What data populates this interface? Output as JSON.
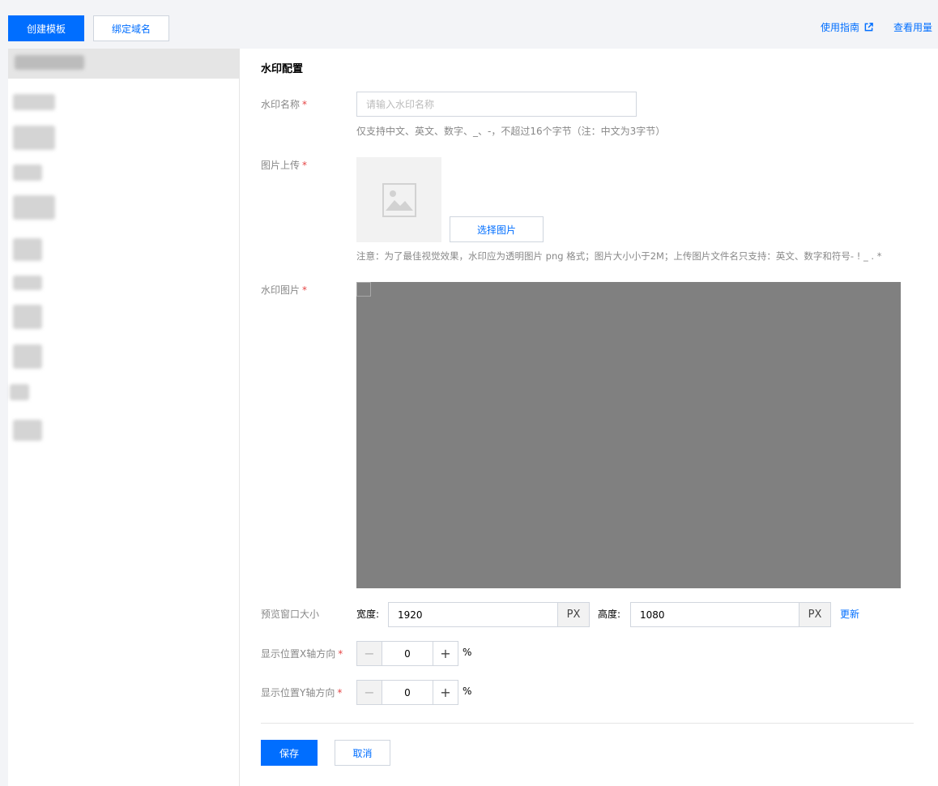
{
  "toolbar": {
    "create_label": "创建模板",
    "bind_label": "绑定域名",
    "guide_label": "使用指南",
    "usage_label": "查看用量"
  },
  "form": {
    "section_title": "水印配置",
    "name": {
      "label": "水印名称",
      "required": "*",
      "placeholder": "请输入水印名称",
      "value": "",
      "hint": "仅支持中文、英文、数字、_、-，不超过16个字节（注：中文为3字节）"
    },
    "upload": {
      "label": "图片上传",
      "required": "*",
      "button_label": "选择图片",
      "hint": "注意：为了最佳视觉效果，水印应为透明图片 png 格式；图片大小小于2M；上传图片文件名只支持：英文、数字和符号- ! _ . *"
    },
    "watermark_image": {
      "label": "水印图片",
      "required": "*"
    },
    "preview_size": {
      "label": "预览窗口大小",
      "width_label": "宽度:",
      "width_value": "1920",
      "width_unit": "PX",
      "height_label": "高度:",
      "height_value": "1080",
      "height_unit": "PX",
      "update_label": "更新"
    },
    "pos_x": {
      "label": "显示位置X轴方向",
      "required": "*",
      "minus": "−",
      "value": "0",
      "plus": "+",
      "unit": "%"
    },
    "pos_y": {
      "label": "显示位置Y轴方向",
      "required": "*",
      "minus": "−",
      "value": "0",
      "plus": "+",
      "unit": "%"
    },
    "save_label": "保存",
    "cancel_label": "取消"
  },
  "colors": {
    "primary": "#006eff",
    "required": "#e54545",
    "preview_bg": "#808080"
  },
  "icons": {
    "external_link": "external-link-icon",
    "image_placeholder": "image-icon"
  }
}
